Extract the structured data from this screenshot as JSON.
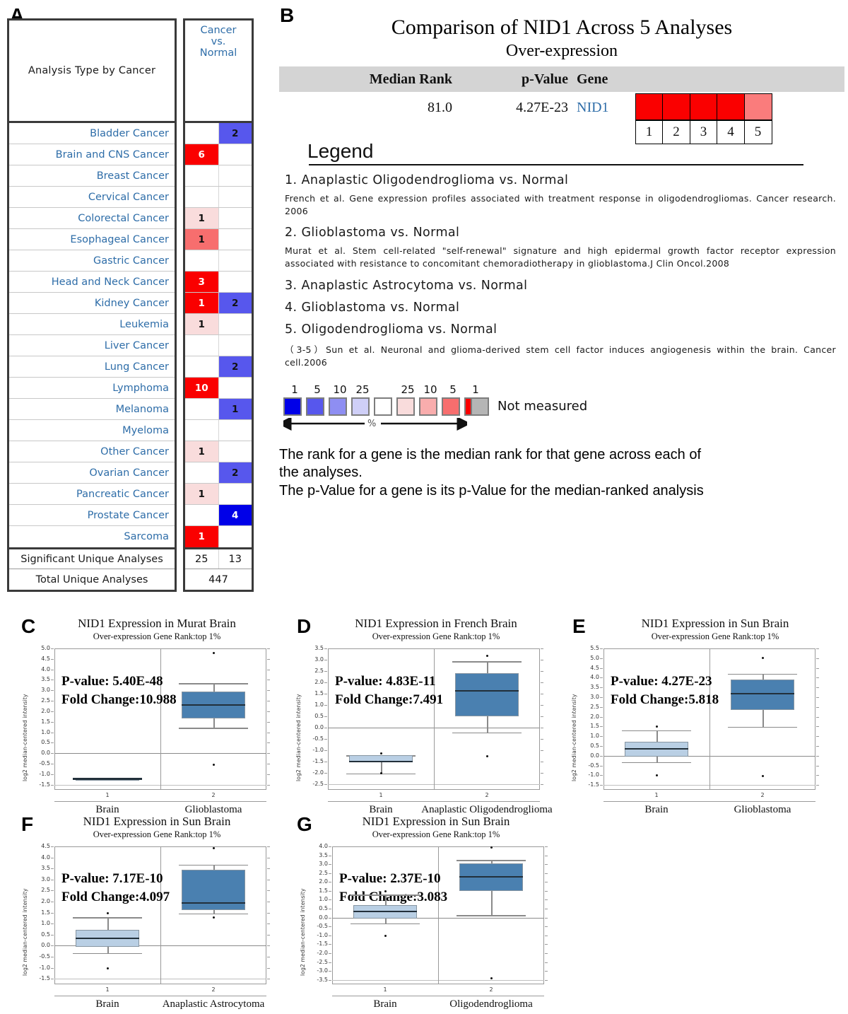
{
  "panels": {
    "a_letter": "A",
    "b_letter": "B",
    "c_letter": "C",
    "d_letter": "D",
    "e_letter": "E",
    "f_letter": "F",
    "g_letter": "G"
  },
  "oncoprint": {
    "header_left": "Analysis Type by Cancer",
    "header_right": "Cancer\nvs.\nNormal",
    "header_right_lines": [
      "Cancer",
      "vs.",
      "Normal"
    ],
    "rows": [
      {
        "label": "Bladder Cancer",
        "over": null,
        "under": 2,
        "over_pct": null,
        "under_pct": 5
      },
      {
        "label": "Brain and CNS Cancer",
        "over": 6,
        "under": null,
        "over_pct": 1,
        "under_pct": null
      },
      {
        "label": "Breast Cancer",
        "over": null,
        "under": null,
        "over_pct": null,
        "under_pct": null
      },
      {
        "label": "Cervical Cancer",
        "over": null,
        "under": null,
        "over_pct": null,
        "under_pct": null
      },
      {
        "label": "Colorectal Cancer",
        "over": 1,
        "under": null,
        "over_pct": 25,
        "under_pct": null
      },
      {
        "label": "Esophageal Cancer",
        "over": 1,
        "under": null,
        "over_pct": 5,
        "under_pct": null
      },
      {
        "label": "Gastric Cancer",
        "over": null,
        "under": null,
        "over_pct": null,
        "under_pct": null
      },
      {
        "label": "Head and Neck Cancer",
        "over": 3,
        "under": null,
        "over_pct": 1,
        "under_pct": null
      },
      {
        "label": "Kidney Cancer",
        "over": 1,
        "under": 2,
        "over_pct": 1,
        "under_pct": 5
      },
      {
        "label": "Leukemia",
        "over": 1,
        "under": null,
        "over_pct": 25,
        "under_pct": null
      },
      {
        "label": "Liver Cancer",
        "over": null,
        "under": null,
        "over_pct": null,
        "under_pct": null
      },
      {
        "label": "Lung Cancer",
        "over": null,
        "under": 2,
        "over_pct": null,
        "under_pct": 5
      },
      {
        "label": "Lymphoma",
        "over": 10,
        "under": null,
        "over_pct": 1,
        "under_pct": null
      },
      {
        "label": "Melanoma",
        "over": null,
        "under": 1,
        "over_pct": null,
        "under_pct": 5
      },
      {
        "label": "Myeloma",
        "over": null,
        "under": null,
        "over_pct": null,
        "under_pct": null
      },
      {
        "label": "Other Cancer",
        "over": 1,
        "under": null,
        "over_pct": 25,
        "under_pct": null
      },
      {
        "label": "Ovarian Cancer",
        "over": null,
        "under": 2,
        "over_pct": null,
        "under_pct": 5
      },
      {
        "label": "Pancreatic Cancer",
        "over": 1,
        "under": null,
        "over_pct": 25,
        "under_pct": null
      },
      {
        "label": "Prostate Cancer",
        "over": null,
        "under": 4,
        "over_pct": null,
        "under_pct": 1
      },
      {
        "label": "Sarcoma",
        "over": 1,
        "under": null,
        "over_pct": 1,
        "under_pct": null
      }
    ],
    "significant_label": "Significant Unique Analyses",
    "significant_over": "25",
    "significant_under": "13",
    "total_label": "Total Unique Analyses",
    "total_value": "447"
  },
  "comparison": {
    "title": "Comparison of NID1 Across 5 Analyses",
    "subtitle": "Over-expression",
    "col_median_rank": "Median Rank",
    "col_pvalue": "p-Value",
    "col_gene": "Gene",
    "median_rank": "81.0",
    "pvalue": "4.27E-23",
    "gene": "NID1",
    "analysis_numbers": [
      "1",
      "2",
      "3",
      "4",
      "5"
    ],
    "swatch_colors": [
      "#FA0000",
      "#FA0000",
      "#FA0000",
      "#FA0000",
      "#FA7C7C"
    ]
  },
  "legend": {
    "heading": "Legend",
    "items": [
      "1. Anaplastic  Oligodendroglioma  vs.  Normal",
      "2. Glioblastoma  vs.  Normal",
      "3. Anaplastic  Astrocytoma  vs.  Normal",
      "4. Glioblastoma  vs.  Normal",
      "5. Oligodendroglioma  vs.  Normal"
    ],
    "ref1": "French et al. Gene expression profiles associated with treatment response in oligodendrogliomas. Cancer research. 2006",
    "ref2": "Murat et al. Stem cell-related \"self-renewal\" signature and high epidermal growth factor receptor expression associated with resistance to concomitant chemoradiotherapy in glioblastoma.J Clin Oncol.2008",
    "ref3": "（3-5）Sun et al. Neuronal and glioma-derived stem cell factor induces angiogenesis within the brain. Cancer cell.2006",
    "scale_labels": [
      "1",
      "5",
      "10",
      "25",
      "",
      "25",
      "10",
      "5",
      "1"
    ],
    "scale_colors": [
      "#0000E8",
      "#5757ED",
      "#8E8EF2",
      "#CFCFF7",
      "#FFFFFF",
      "#F9DCDC",
      "#F9ADAD",
      "#F76E6E",
      "#FA0000"
    ],
    "pct_symbol": "%",
    "not_measured": "Not measured",
    "note_line1": "The rank for a gene is the median rank for that gene across each of",
    "note_line2": "the analyses.",
    "note_line3": "The p-Value for a gene is its p-Value for the median-ranked analysis"
  },
  "chart_data": [
    {
      "id": "C",
      "type": "box",
      "title": "NID1 Expression in Murat Brain",
      "subtitle": "Over-expression Gene Rank:top 1%",
      "ylabel": "log2 median-centered intensity",
      "pvalue_text": "P-value: 5.40E-48",
      "fold_text": "Fold Change:10.988",
      "ylim": [
        -1.75,
        5.0
      ],
      "yticks": [
        5.0,
        4.5,
        4.0,
        3.5,
        3.0,
        2.5,
        2.0,
        1.5,
        1.0,
        0.5,
        0.0,
        -0.5,
        -1.0,
        -1.5
      ],
      "groups": [
        {
          "num": "1",
          "label": "Brain",
          "q1": -1.21,
          "median": -1.21,
          "q3": -1.21,
          "whisker_low": -1.21,
          "whisker_high": -1.21,
          "outliers": [],
          "fill": "#b9cfe4",
          "flat": true
        },
        {
          "num": "2",
          "label": "Glioblastoma",
          "q1": 1.65,
          "median": 2.3,
          "q3": 2.94,
          "whisker_low": 1.21,
          "whisker_high": 3.34,
          "outliers": [
            4.79,
            -0.55
          ],
          "fill": "#4a80b0"
        }
      ]
    },
    {
      "id": "D",
      "type": "box",
      "title": "NID1 Expression in French Brain",
      "subtitle": "Over-expression Gene Rank:top 1%",
      "ylabel": "log2 median-centered intensity",
      "pvalue_text": "P-value: 4.83E-11",
      "fold_text": "Fold Change:7.491",
      "ylim": [
        -2.75,
        3.5
      ],
      "yticks": [
        3.5,
        3.0,
        2.5,
        2.0,
        1.5,
        1.0,
        0.5,
        0.0,
        -0.5,
        -1.0,
        -1.5,
        -2.0,
        -2.5
      ],
      "groups": [
        {
          "num": "1",
          "label": "Brain",
          "q1": -1.52,
          "median": -1.5,
          "q3": -1.22,
          "whisker_low": -2.03,
          "whisker_high": -1.22,
          "outliers": [
            -1.14,
            -2.03
          ],
          "fill": "#b9cfe4"
        },
        {
          "num": "2",
          "label": "Anaplastic Oligodendroglioma",
          "q1": 0.5,
          "median": 1.63,
          "q3": 2.42,
          "whisker_low": -0.21,
          "whisker_high": 2.93,
          "outliers": [
            3.16,
            -1.27
          ],
          "fill": "#4a80b0"
        }
      ]
    },
    {
      "id": "E",
      "type": "box",
      "title": "NID1 Expression in Sun Brain",
      "subtitle": "Over-expression Gene Rank:top 1%",
      "ylabel": "log2 median-centered intensity",
      "pvalue_text": "P-value: 4.27E-23",
      "fold_text": "Fold Change:5.818",
      "ylim": [
        -1.75,
        5.5
      ],
      "yticks": [
        5.5,
        5.0,
        4.5,
        4.0,
        3.5,
        3.0,
        2.5,
        2.0,
        1.5,
        1.0,
        0.5,
        0.0,
        -0.5,
        -1.0,
        -1.5
      ],
      "groups": [
        {
          "num": "1",
          "label": "Brain",
          "q1": -0.04,
          "median": 0.34,
          "q3": 0.71,
          "whisker_low": -0.33,
          "whisker_high": 1.3,
          "outliers": [
            1.48,
            -1.02
          ],
          "fill": "#b9cfe4"
        },
        {
          "num": "2",
          "label": "Glioblastoma",
          "q1": 2.33,
          "median": 3.19,
          "q3": 3.9,
          "whisker_low": 1.48,
          "whisker_high": 4.2,
          "outliers": [
            5.0,
            -1.04
          ],
          "fill": "#4a80b0"
        }
      ]
    },
    {
      "id": "F",
      "type": "box",
      "title": "NID1 Expression in Sun Brain",
      "subtitle": "Over-expression Gene Rank:top 1%",
      "ylabel": "log2 median-centered intensity",
      "pvalue_text": "P-value: 7.17E-10",
      "fold_text": "Fold Change:4.097",
      "ylim": [
        -1.75,
        4.5
      ],
      "yticks": [
        4.5,
        4.0,
        3.5,
        3.0,
        2.5,
        2.0,
        1.5,
        1.0,
        0.5,
        0.0,
        -0.5,
        -1.0,
        -1.5
      ],
      "groups": [
        {
          "num": "1",
          "label": "Brain",
          "q1": -0.06,
          "median": 0.34,
          "q3": 0.72,
          "whisker_low": -0.33,
          "whisker_high": 1.29,
          "outliers": [
            1.47,
            -1.03
          ],
          "fill": "#b9cfe4"
        },
        {
          "num": "2",
          "label": "Anaplastic Astrocytoma",
          "q1": 1.62,
          "median": 1.93,
          "q3": 3.43,
          "whisker_low": 1.47,
          "whisker_high": 3.67,
          "outliers": [
            4.42,
            1.27
          ],
          "fill": "#4a80b0"
        }
      ]
    },
    {
      "id": "G",
      "type": "box",
      "title": "NID1 Expression in Sun Brain",
      "subtitle": "Over-expression Gene Rank:top 1%",
      "ylabel": "log2 median-centered intensity",
      "pvalue_text": "P-value: 2.37E-10",
      "fold_text": "Fold Change:3.083",
      "ylim": [
        -3.75,
        4.0
      ],
      "yticks": [
        4.0,
        3.5,
        3.0,
        2.5,
        2.0,
        1.5,
        1.0,
        0.5,
        0.0,
        -0.5,
        -1.0,
        -1.5,
        -2.0,
        -2.5,
        -3.0,
        -3.5
      ],
      "groups": [
        {
          "num": "1",
          "label": "Brain",
          "q1": -0.05,
          "median": 0.33,
          "q3": 0.72,
          "whisker_low": -0.33,
          "whisker_high": 1.29,
          "outliers": [
            1.47,
            -1.02
          ],
          "fill": "#b9cfe4"
        },
        {
          "num": "2",
          "label": "Oligodendroglioma",
          "q1": 1.51,
          "median": 2.31,
          "q3": 3.03,
          "whisker_low": 0.14,
          "whisker_high": 3.24,
          "outliers": [
            3.94,
            -3.42
          ],
          "fill": "#4a80b0"
        }
      ]
    }
  ]
}
